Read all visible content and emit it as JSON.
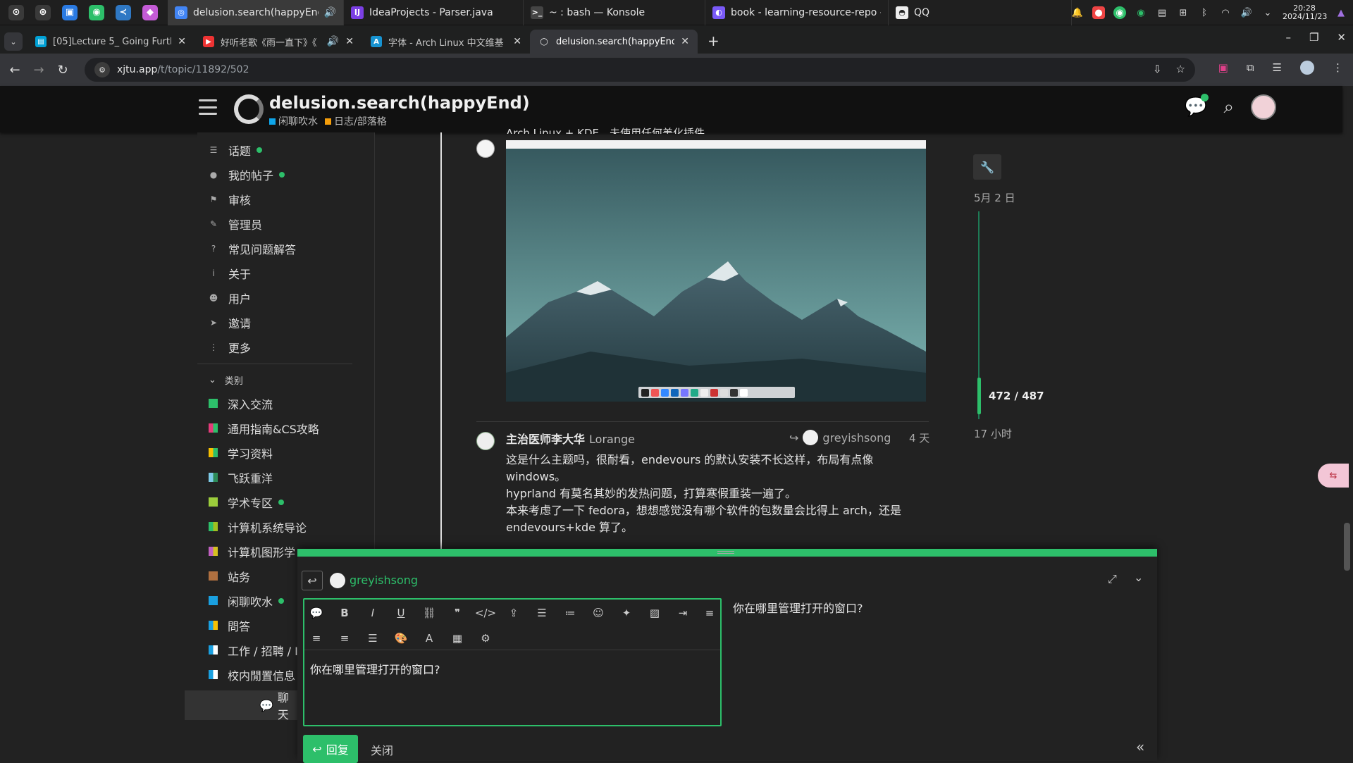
{
  "taskbar": {
    "apps": [
      {
        "name": "overview-icon",
        "color": "#3a3a3a",
        "glyph": "⊙"
      },
      {
        "name": "browser-icon",
        "color": "#3a3a3a",
        "glyph": "⊛"
      },
      {
        "name": "files-icon",
        "color": "#2a7ae2",
        "glyph": "▣"
      },
      {
        "name": "wechat-icon",
        "color": "#2dbf6a",
        "glyph": "◉"
      },
      {
        "name": "vscode-icon",
        "color": "#2f78c4",
        "glyph": "≺"
      },
      {
        "name": "app-icon",
        "color": "#c45bd6",
        "glyph": "◆"
      }
    ],
    "windows": [
      {
        "title": "delusion.search(happyEnd) ...",
        "icon_color": "#4285f4",
        "glyph": "◎",
        "extra": "🔊",
        "active": true
      },
      {
        "title": "IdeaProjects - Parser.java",
        "icon_color": "#7b3fe4",
        "glyph": "IJ",
        "active": false
      },
      {
        "title": "~ : bash — Konsole",
        "icon_color": "#444444",
        "glyph": ">_",
        "active": false
      },
      {
        "title": "book - learning-resource-repo - ...",
        "icon_color": "#7a5af8",
        "glyph": "◐",
        "active": false
      },
      {
        "title": "QQ",
        "icon_color": "#eeeeee",
        "glyph": "◓",
        "active": false
      }
    ],
    "clock_time": "20:28",
    "clock_date": "2024/11/23"
  },
  "browser": {
    "tabs": [
      {
        "title": "[05]Lecture 5_ Going Furthe",
        "icon_color": "#00a1d6",
        "glyph": "▤",
        "active": false
      },
      {
        "title": "好听老歌《雨一直下》《",
        "icon_color": "#e33",
        "glyph": "▶",
        "active": false
      },
      {
        "title": "字体 - Arch Linux 中文维基",
        "icon_color": "#1793d1",
        "glyph": "A",
        "active": false
      },
      {
        "title": "delusion.search(happyEnd)",
        "icon_color": "#35363a",
        "glyph": "◯",
        "active": true
      }
    ],
    "url_host": "xjtu.app",
    "url_path": "/t/topic/11892/502"
  },
  "header": {
    "title": "delusion.search(happyEnd)",
    "crumbs": [
      {
        "label": "闲聊吹水",
        "color": "#0ea5e9"
      },
      {
        "label": "日志/部落格",
        "color": "#f59e0b"
      }
    ]
  },
  "sidebar": {
    "items": [
      {
        "label": "话题",
        "icon": "☰",
        "dot": true
      },
      {
        "label": "我的帖子",
        "icon": "●",
        "dot": true
      },
      {
        "label": "审核",
        "icon": "⚑",
        "dot": false
      },
      {
        "label": "管理员",
        "icon": "✎",
        "dot": false
      },
      {
        "label": "常见问题解答",
        "icon": "?",
        "dot": false
      },
      {
        "label": "关于",
        "icon": "i",
        "dot": false
      },
      {
        "label": "用户",
        "icon": "☻",
        "dot": false
      },
      {
        "label": "邀请",
        "icon": "➤",
        "dot": false
      },
      {
        "label": "更多",
        "icon": "⋮",
        "dot": false
      }
    ],
    "section_label": "类别",
    "categories": [
      {
        "label": "深入交流",
        "color": "#2dbf6a",
        "color2": "#2dbf6a",
        "dot": false
      },
      {
        "label": "通用指南&CS攻略",
        "color": "#e43b7a",
        "color2": "#2dbf6a",
        "dot": false
      },
      {
        "label": "学习资料",
        "color": "#f6c000",
        "color2": "#2dbf6a",
        "dot": false
      },
      {
        "label": "飞跃重洋",
        "color": "#7ecbe8",
        "color2": "#2d8c5a",
        "dot": false
      },
      {
        "label": "学术专区",
        "color": "#9ccd3c",
        "color2": "#9ccd3c",
        "dot": true
      },
      {
        "label": "计算机系统导论",
        "color": "#2dbf6a",
        "color2": "#a0c020",
        "dot": false
      },
      {
        "label": "计算机图形学",
        "color": "#c060c0",
        "color2": "#d4c020",
        "dot": false
      },
      {
        "label": "站务",
        "color": "#b07040",
        "color2": "#b07040",
        "dot": false
      },
      {
        "label": "闲聊吹水",
        "color": "#1aa0e0",
        "color2": "#1aa0e0",
        "dot": true
      },
      {
        "label": "問答",
        "color": "#1aa0e0",
        "color2": "#f6c000",
        "dot": false
      },
      {
        "label": "工作 / 招聘 / I",
        "color": "#1aa0e0",
        "color2": "#ffffff",
        "dot": false
      },
      {
        "label": "校内閒置信息",
        "color": "#1aa0e0",
        "color2": "#ffffff",
        "dot": false
      }
    ],
    "chat_label": "聊天"
  },
  "posts": {
    "first_text": "Arch Linux + KDE，未使用任何美化插件",
    "second": {
      "author": "主治医师李大华",
      "username": "Lorange",
      "reply_to": "greyishsong",
      "time": "4 天",
      "lines": [
        "这是什么主题吗，很耐看，endevours 的默认安装不长这样，布局有点像",
        "windows。",
        "hyprland 有莫名其妙的发热问题，打算寒假重装一遍了。",
        "本来考虑了一下 fedora，想想感觉没有哪个软件的包数量会比得上 arch，还是",
        "endevours+kde 算了。"
      ]
    }
  },
  "timeline": {
    "date": "5月 2 日",
    "count": "472 / 487",
    "ago": "17 小时"
  },
  "composer": {
    "reply_to_user": "greyishsong",
    "text": "你在哪里管理打开的窗口?",
    "preview": "你在哪里管理打开的窗口?",
    "reply_label": "回复",
    "close_label": "关闭"
  }
}
